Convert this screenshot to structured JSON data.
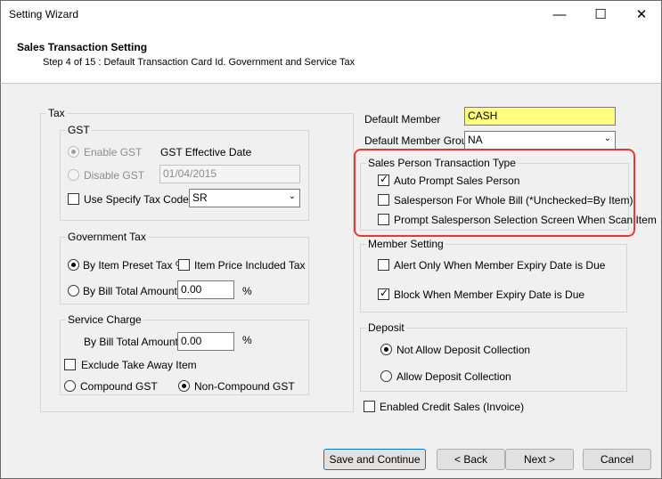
{
  "window": {
    "title": "Setting Wizard"
  },
  "header": {
    "title": "Sales Transaction Setting",
    "step": "Step 4 of 15 : Default Transaction Card Id. Government and Service Tax"
  },
  "tax": {
    "label": "Tax",
    "gst": {
      "label": "GST",
      "enable_label": "Enable GST",
      "disable_label": "Disable GST",
      "effective_date_label": "GST Effective Date",
      "effective_date_value": "01/04/2015",
      "use_specify_tax_code_label": "Use Specify Tax Code",
      "tax_code_value": "SR"
    },
    "government_tax": {
      "label": "Government Tax",
      "by_item_preset_label": "By Item Preset Tax %",
      "item_price_included_label": "Item Price Included Tax",
      "by_bill_total_label": "By Bill Total Amount",
      "by_bill_total_value": "0.00",
      "percent": "%"
    },
    "service_charge": {
      "label": "Service Charge",
      "by_bill_total_label": "By Bill Total Amount",
      "by_bill_total_value": "0.00",
      "percent": "%",
      "exclude_take_away_label": "Exclude Take Away Item",
      "compound_gst_label": "Compound GST",
      "non_compound_gst_label": "Non-Compound GST"
    }
  },
  "default_member": {
    "label": "Default Member",
    "value": "CASH"
  },
  "default_member_group": {
    "label": "Default Member Group",
    "value": "NA"
  },
  "sales_person": {
    "label": "Sales Person Transaction Type",
    "auto_prompt": "Auto Prompt Sales Person",
    "whole_bill": "Salesperson For Whole Bill (*Unchecked=By Item)",
    "prompt_scan": "Prompt Salesperson Selection Screen When Scan Item"
  },
  "member_setting": {
    "label": "Member Setting",
    "alert_only": "Alert Only When Member Expiry Date is Due",
    "block": "Block When Member Expiry Date is Due"
  },
  "deposit": {
    "label": "Deposit",
    "not_allow": "Not Allow Deposit Collection",
    "allow": "Allow Deposit Collection"
  },
  "enabled_credit_sales": "Enabled Credit  Sales (Invoice)",
  "buttons": {
    "save": "Save and Continue",
    "back": "< Back",
    "next": "Next >",
    "cancel": "Cancel"
  },
  "colors": {
    "highlight": "#e53935",
    "member_field": "#ffff80",
    "accent": "#0078d7"
  }
}
